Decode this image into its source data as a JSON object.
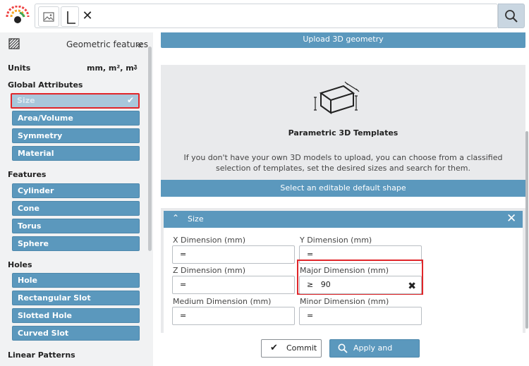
{
  "search": {
    "value": "",
    "clear_label": "✕",
    "shape_chip_symbol": "L"
  },
  "sidebar": {
    "title": "Geometric features",
    "units_label": "Units",
    "units_value": "mm, m², m³",
    "sections": {
      "global": "Global Attributes",
      "features": "Features",
      "holes": "Holes",
      "linear": "Linear Patterns"
    },
    "global_items": [
      "Size",
      "Area/Volume",
      "Symmetry",
      "Material"
    ],
    "feature_items": [
      "Cylinder",
      "Cone",
      "Torus",
      "Sphere"
    ],
    "hole_items": [
      "Hole",
      "Rectangular Slot",
      "Slotted Hole",
      "Curved Slot"
    ]
  },
  "main": {
    "upload_label": "Upload 3D geometry",
    "templates_title": "Parametric 3D Templates",
    "templates_desc": "If you don't have your own 3D models to upload, you can choose from a classified selection of templates, set the desired sizes and search for them.",
    "select_shape_label": "Select an editable default shape",
    "size_panel": {
      "title": "Size",
      "fields": {
        "x": {
          "label": "X Dimension (mm)",
          "value": "="
        },
        "y": {
          "label": "Y Dimension (mm)",
          "value": "="
        },
        "z": {
          "label": "Z Dimension (mm)",
          "value": "="
        },
        "major": {
          "label": "Major Dimension (mm)",
          "value": "≥   90"
        },
        "medium": {
          "label": "Medium Dimension (mm)",
          "value": "="
        },
        "minor": {
          "label": "Minor Dimension (mm)",
          "value": "="
        }
      }
    }
  },
  "footer": {
    "commit_label": "Commit",
    "apply_label": "Apply and search"
  },
  "colors": {
    "accent": "#5b98bd",
    "highlight": "#e0262a",
    "sidebar_bg": "#f1f2f3"
  }
}
